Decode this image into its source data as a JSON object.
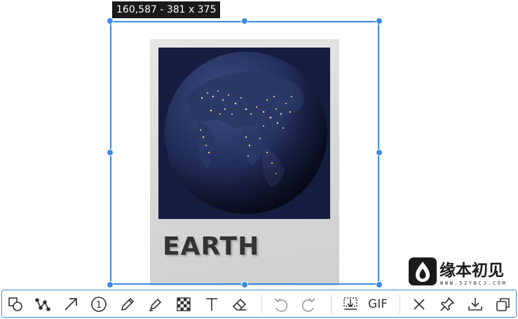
{
  "selection": {
    "size_label": "160,587 - 381 x 375"
  },
  "captured_card": {
    "title": "EARTH",
    "photo_icon": "earth-at-night-image"
  },
  "watermark": {
    "brand_text": "缘本初见",
    "sub_text": "WWW.52YBCJ.COM",
    "icon": "flame-drop-logo"
  },
  "toolbar": {
    "tools": [
      {
        "name": "shape",
        "icon": "shapes-icon"
      },
      {
        "name": "curve",
        "icon": "polyline-icon"
      },
      {
        "name": "arrow",
        "icon": "arrow-icon"
      },
      {
        "name": "serial-number",
        "icon": "number-marker-icon",
        "label": "1"
      },
      {
        "name": "pen",
        "icon": "pen-icon"
      },
      {
        "name": "marker",
        "icon": "highlighter-icon"
      },
      {
        "name": "mosaic",
        "icon": "mosaic-icon"
      },
      {
        "name": "text",
        "icon": "text-icon"
      },
      {
        "name": "eraser",
        "icon": "eraser-icon"
      },
      {
        "name": "undo",
        "icon": "undo-icon"
      },
      {
        "name": "redo",
        "icon": "redo-icon"
      },
      {
        "name": "long-screenshot",
        "icon": "scroll-capture-icon"
      },
      {
        "name": "gif",
        "icon": "gif-icon"
      },
      {
        "name": "cancel",
        "icon": "close-icon"
      },
      {
        "name": "pin",
        "icon": "pin-icon"
      },
      {
        "name": "save",
        "icon": "download-icon"
      },
      {
        "name": "copy",
        "icon": "copy-icon"
      }
    ],
    "gif_label": "GIF",
    "serial_number_label": "1"
  }
}
